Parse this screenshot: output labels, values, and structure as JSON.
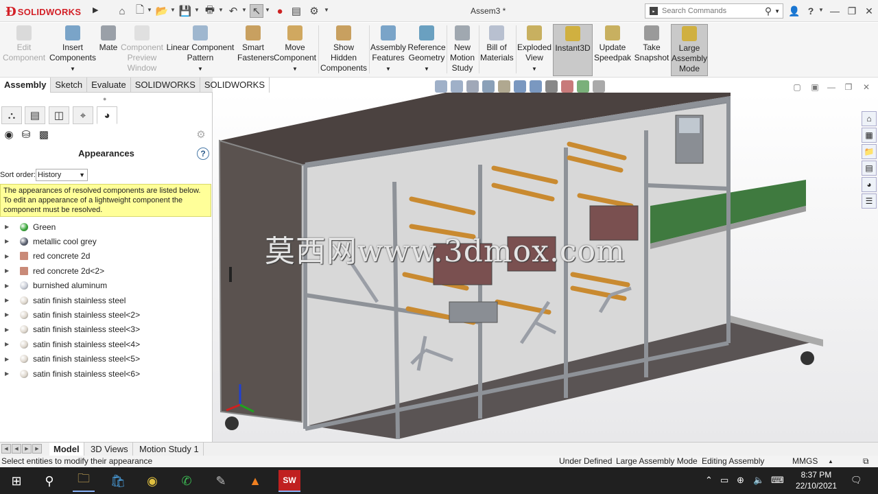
{
  "app": {
    "brand": "SOLIDWORKS",
    "doc_title": "Assem3 *",
    "search_placeholder": "Search Commands"
  },
  "command_manager": [
    {
      "label": "Edit Component",
      "disabled": true
    },
    {
      "label": "Insert Components"
    },
    {
      "label": "Mate"
    },
    {
      "label": "Component Preview Window",
      "disabled": true
    },
    {
      "label": "Linear Component Pattern"
    },
    {
      "label": "Smart Fasteners"
    },
    {
      "label": "Move Component"
    },
    {
      "label": "Show Hidden Components"
    },
    {
      "label": "Assembly Features"
    },
    {
      "label": "Reference Geometry"
    },
    {
      "label": "New Motion Study"
    },
    {
      "label": "Bill of Materials"
    },
    {
      "label": "Exploded View"
    },
    {
      "label": "Instant3D",
      "active": true
    },
    {
      "label": "Update Speedpak"
    },
    {
      "label": "Take Snapshot"
    },
    {
      "label": "Large Assembly Mode",
      "active": true
    }
  ],
  "tabs": [
    "Assembly",
    "Sketch",
    "Evaluate",
    "SOLIDWORKS Add-Ins",
    "SOLIDWORKS MBD"
  ],
  "panel": {
    "title": "Appearances",
    "help": "?",
    "sort_label": "Sort order:",
    "sort_value": "History",
    "note": "The appearances of resolved components are listed below. To edit an appearance of a lightweight component the component must be resolved.",
    "items": [
      {
        "label": "Green",
        "color": "#3aa83a",
        "shape": "ball"
      },
      {
        "label": "metallic cool grey",
        "color": "#5a6070",
        "shape": "ball"
      },
      {
        "label": "red concrete 2d",
        "color": "#c98a78",
        "shape": "square"
      },
      {
        "label": "red concrete 2d<2>",
        "color": "#c98a78",
        "shape": "square"
      },
      {
        "label": "burnished aluminum",
        "color": "#c8ccd6",
        "shape": "ball"
      },
      {
        "label": "satin finish stainless steel",
        "color": "#ddd6cc",
        "shape": "ball"
      },
      {
        "label": "satin finish stainless steel<2>",
        "color": "#ddd6cc",
        "shape": "ball"
      },
      {
        "label": "satin finish stainless steel<3>",
        "color": "#ddd6cc",
        "shape": "ball"
      },
      {
        "label": "satin finish stainless steel<4>",
        "color": "#ddd6cc",
        "shape": "ball"
      },
      {
        "label": "satin finish stainless steel<5>",
        "color": "#ddd6cc",
        "shape": "ball"
      },
      {
        "label": "satin finish stainless steel<6>",
        "color": "#ddd6cc",
        "shape": "ball"
      }
    ]
  },
  "bottom_tabs": [
    "Model",
    "3D Views",
    "Motion Study 1"
  ],
  "status": {
    "left": "Select entities to modify their appearance",
    "under_defined": "Under Defined",
    "mode": "Large Assembly Mode",
    "editing": "Editing Assembly",
    "units": "MMGS"
  },
  "watermark": "莫西网www.3dmox.com",
  "taskbar": {
    "time": "8:37 PM",
    "date": "22/10/2021"
  }
}
